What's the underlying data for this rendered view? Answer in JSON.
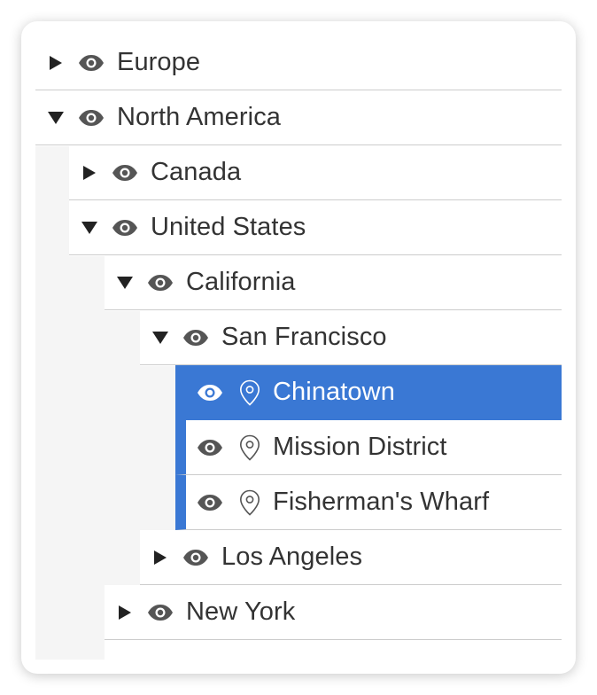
{
  "tree": {
    "europe": {
      "label": "Europe",
      "expanded": false
    },
    "north_america": {
      "label": "North America",
      "expanded": true,
      "canada": {
        "label": "Canada",
        "expanded": false
      },
      "united_states": {
        "label": "United States",
        "expanded": true,
        "california": {
          "label": "California",
          "expanded": true,
          "san_francisco": {
            "label": "San Francisco",
            "expanded": true,
            "places": [
              {
                "label": "Chinatown",
                "selected": true
              },
              {
                "label": "Mission District",
                "selected": false
              },
              {
                "label": "Fisherman's Wharf",
                "selected": false
              }
            ]
          },
          "los_angeles": {
            "label": "Los Angeles",
            "expanded": false
          }
        },
        "new_york": {
          "label": "New York",
          "expanded": false
        }
      }
    }
  },
  "colors": {
    "selected_background": "#3a78d4",
    "text": "#333333",
    "icon": "#555555",
    "divider": "#cccccc",
    "indent_band": "#f5f5f5"
  },
  "icons": {
    "collapsed": "caret-right-icon",
    "expanded": "caret-down-icon",
    "visibility": "eye-icon",
    "location": "map-pin-icon"
  }
}
